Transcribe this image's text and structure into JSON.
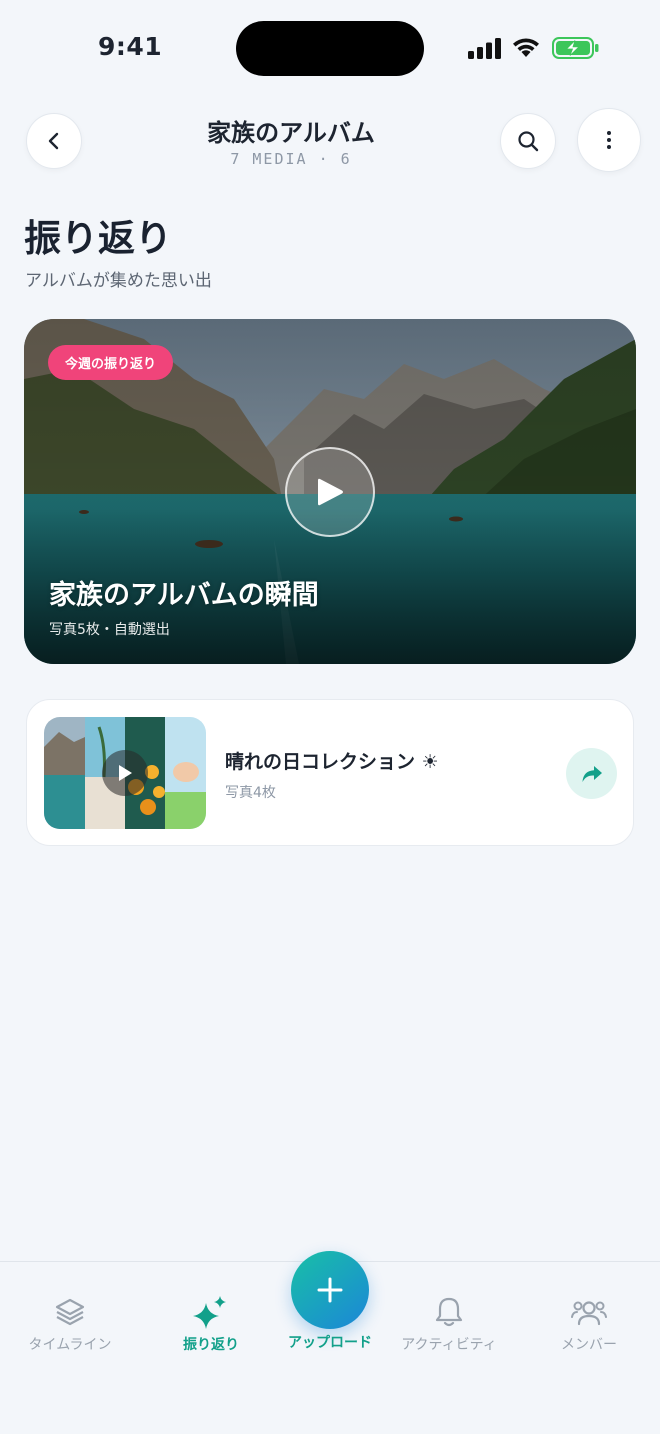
{
  "status": {
    "time": "9:41"
  },
  "header": {
    "title": "家族のアルバム",
    "meta": "7 MEDIA · 6"
  },
  "page": {
    "title": "振り返り",
    "subtitle": "アルバムが集めた思い出"
  },
  "hero": {
    "badge": "今週の振り返り",
    "title": "家族のアルバムの瞬間",
    "subtitle": "写真5枚・自動選出"
  },
  "collection": {
    "title": "晴れの日コレクション ☀",
    "subtitle": "写真4枚"
  },
  "tabbar": {
    "timeline": "タイムライン",
    "recap": "振り返り",
    "upload": "アップロード",
    "activity": "アクティビティ",
    "members": "メンバー"
  },
  "colors": {
    "accent": "#12a08a",
    "badge": "#f0447a",
    "background": "#f3f6fa"
  },
  "icons": [
    "back-icon",
    "search-icon",
    "more-icon",
    "play-icon",
    "share-icon",
    "layers-icon",
    "sparkle-icon",
    "plus-icon",
    "bell-icon",
    "members-icon"
  ]
}
